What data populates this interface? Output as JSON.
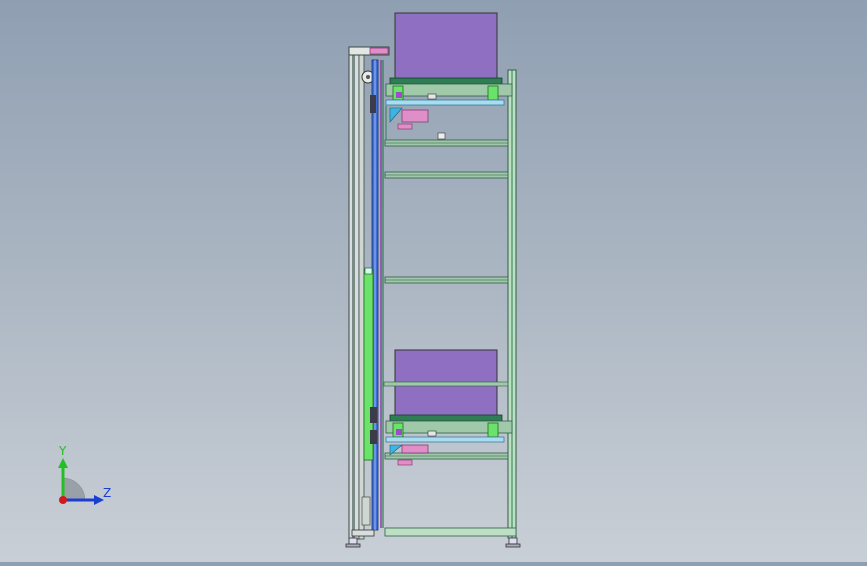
{
  "viewport": {
    "background_top": "#8f9fb2",
    "background_bottom": "#c9cfd6"
  },
  "model": {
    "frame_color": "#2e7d55",
    "rail_color": "#8fd0a0",
    "lift_column_color": "#3d6fd8",
    "cylinder_color": "#6be36b",
    "payload_color": "#8e6fc2",
    "accent_pink": "#e08ec8",
    "accent_cyan": "#3fb4e0"
  },
  "triad": {
    "y_label": "Y",
    "z_label": "Z",
    "y_color": "#22c022",
    "z_color": "#1a3fd0",
    "origin_color": "#d01a1a"
  }
}
